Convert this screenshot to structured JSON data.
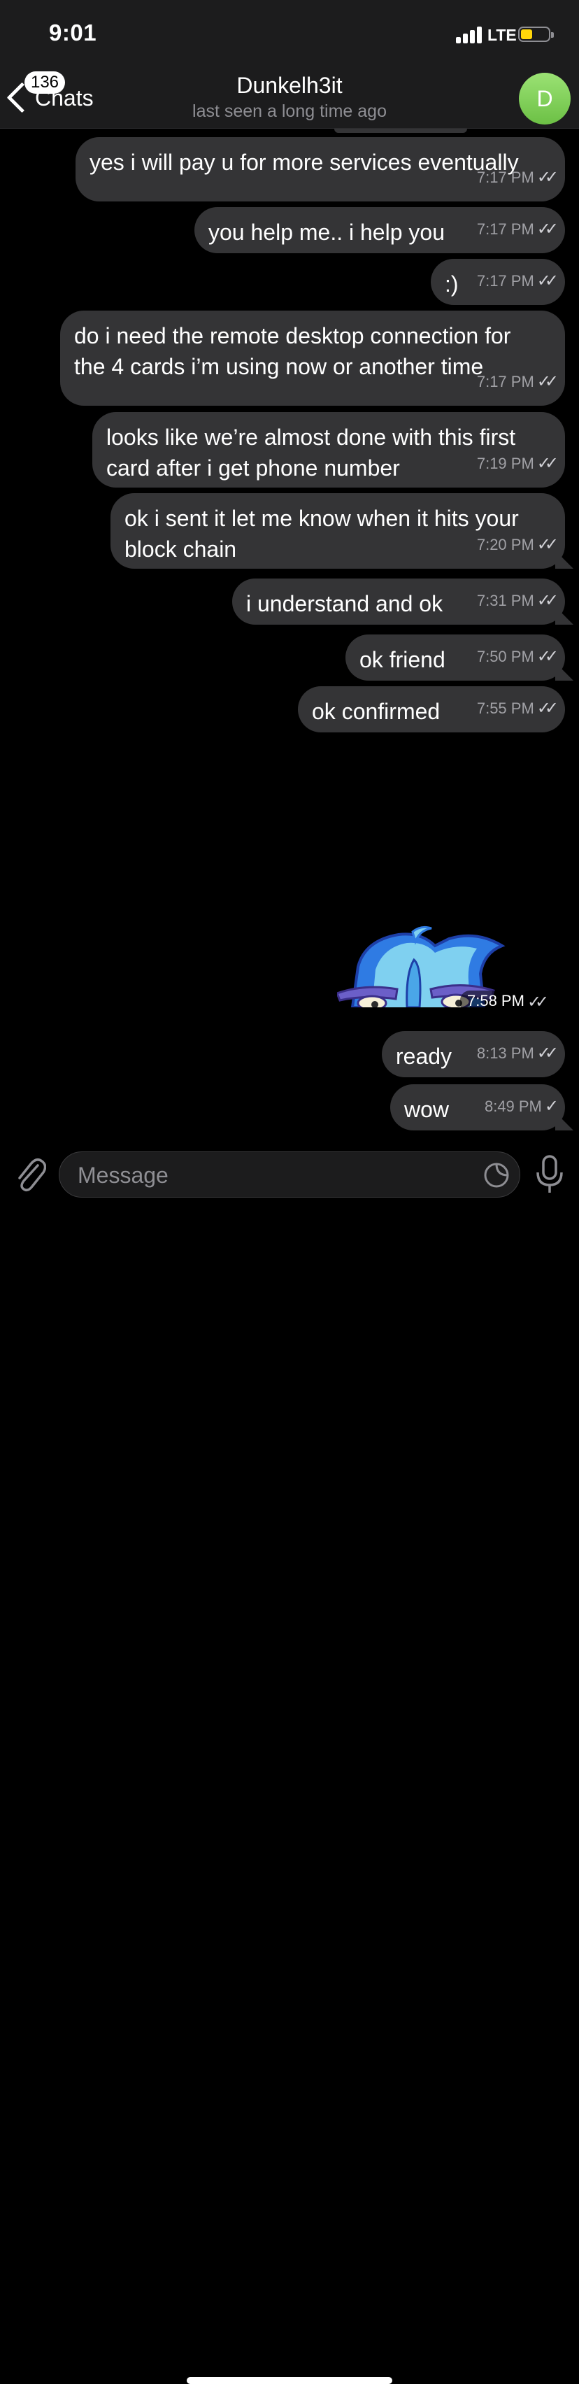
{
  "status_bar": {
    "time": "9:01",
    "network": "LTE",
    "battery_color": "#ffd60a"
  },
  "header": {
    "back_label": "Chats",
    "unread_count": "136",
    "contact_name": "Dunkelh3it",
    "contact_status": "last seen a long time ago",
    "avatar_letter": "D",
    "avatar_color": "#7ccd55"
  },
  "messages": [
    {
      "text": "yes i will pay u for more services eventually",
      "time": "7:17 PM",
      "status": "read"
    },
    {
      "text": "you help me.. i help you",
      "time": "7:17 PM",
      "status": "read"
    },
    {
      "text": ":)",
      "time": "7:17 PM",
      "status": "read"
    },
    {
      "text": "do i need the remote desktop connection for the 4 cards i’m using now or another time",
      "time": "7:17 PM",
      "status": "read"
    },
    {
      "text": "looks like we’re almost done with this first card after i get phone number",
      "time": "7:19 PM",
      "status": "read"
    },
    {
      "text": "ok i sent it let me know when it hits your block chain",
      "time": "7:20 PM",
      "status": "read"
    },
    {
      "text": "i understand and ok",
      "time": "7:31 PM",
      "status": "read"
    },
    {
      "text": "ok friend",
      "time": "7:50 PM",
      "status": "read"
    },
    {
      "text": "ok confirmed",
      "time": "7:55 PM",
      "status": "read"
    },
    {
      "sticker": "blue-cartoon-character-sticker",
      "time": "7:58 PM",
      "status": "read"
    },
    {
      "text": "ready",
      "time": "8:13 PM",
      "status": "read"
    },
    {
      "text": "wow",
      "time": "8:49 PM",
      "status": "sent"
    }
  ],
  "check_marks": {
    "read": "✓✓",
    "sent": "✓"
  },
  "composer": {
    "placeholder": "Message"
  },
  "colors": {
    "bubble": "#343436",
    "header": "#1c1c1d",
    "background": "#000000"
  }
}
